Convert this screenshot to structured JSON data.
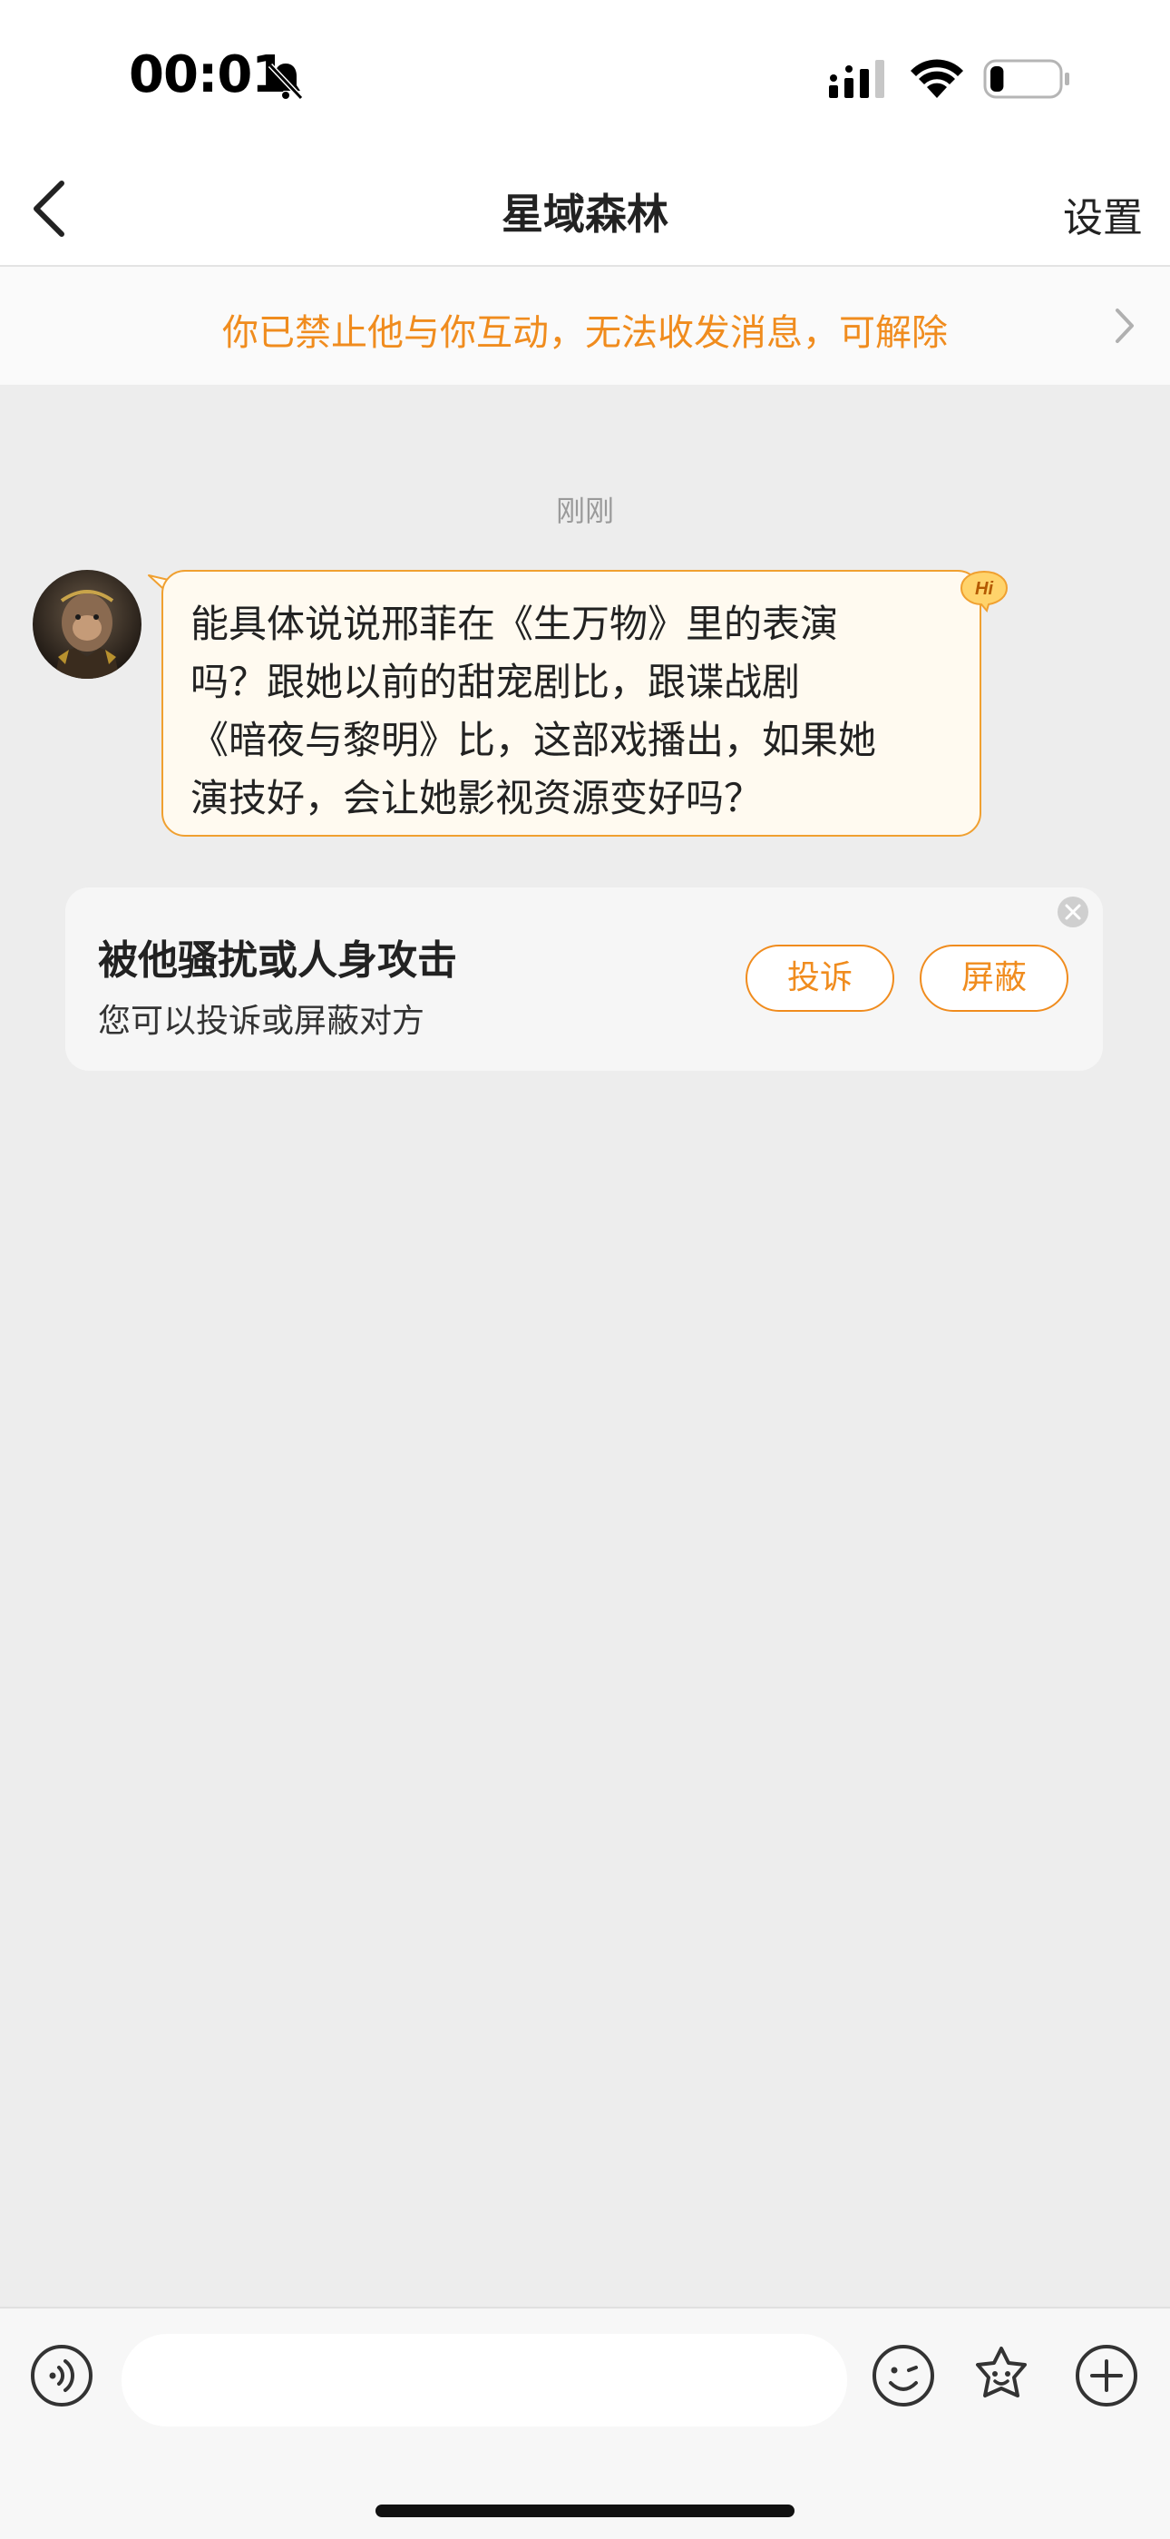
{
  "status_bar": {
    "time": "00:01",
    "battery_level": 0.2
  },
  "header": {
    "title": "星域森林",
    "settings_label": "设置"
  },
  "banner": {
    "text": "你已禁止他与你互动，无法收发消息，可解除"
  },
  "conversation": {
    "timestamp": "刚刚",
    "messages": [
      {
        "sender": "other",
        "badge": "Hi",
        "text": "能具体说说邢菲在《生万物》里的表演\n吗？跟她以前的甜宠剧比，跟谍战剧\n《暗夜与黎明》比，这部戏播出，如果她\n演技好，会让她影视资源变好吗？"
      }
    ]
  },
  "harassment_card": {
    "title": "被他骚扰或人身攻击",
    "subtitle": "您可以投诉或屏蔽对方",
    "complain_label": "投诉",
    "block_label": "屏蔽"
  },
  "input_bar": {
    "placeholder": ""
  },
  "colors": {
    "accent": "#f08c1e",
    "bubble_bg": "#fffaf0",
    "bubble_border": "#f0a030",
    "page_bg": "#ededed"
  }
}
